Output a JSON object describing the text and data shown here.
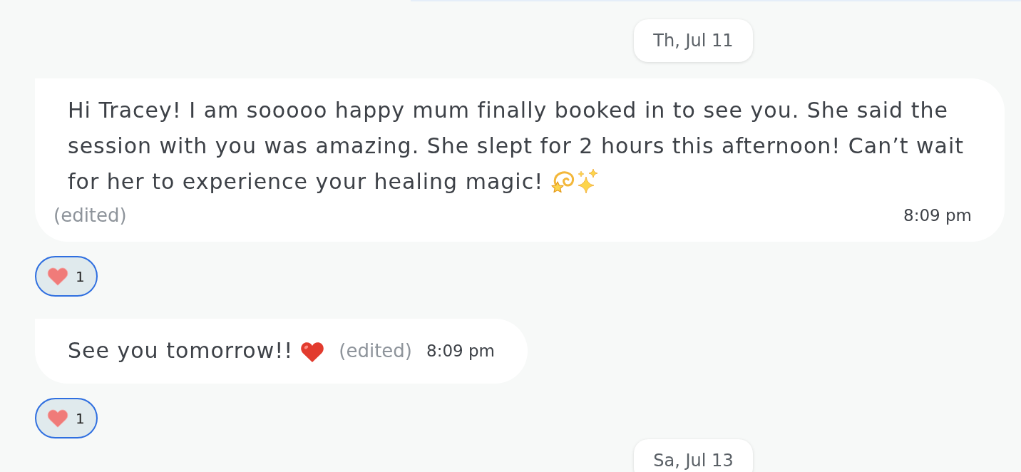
{
  "timeline": [
    {
      "kind": "date",
      "label": "Th, Jul 11"
    },
    {
      "kind": "message",
      "text": "Hi Tracey! I am sooooo happy mum finally booked in to see you. She said the session with you was amazing. She slept for 2 hours this afternoon! Can’t wait for her to experience your healing magic!",
      "emoji": [
        {
          "kind": "dizzy"
        },
        {
          "kind": "sparkles"
        }
      ],
      "edited": "(edited)",
      "time": "8:09 pm",
      "reactions": [
        {
          "kind": "heart",
          "count": "1",
          "selected": true
        }
      ]
    },
    {
      "kind": "message",
      "text": "See you tomorrow!!",
      "emoji": [
        {
          "kind": "heart"
        }
      ],
      "edited": "(edited)",
      "time": "8:09 pm",
      "reactions": [
        {
          "kind": "heart",
          "count": "1",
          "selected": true
        }
      ]
    },
    {
      "kind": "date",
      "label": "Sa, Jul 13"
    }
  ]
}
